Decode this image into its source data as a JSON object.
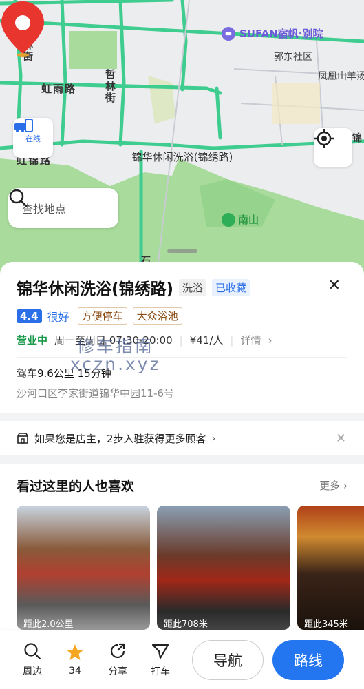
{
  "map": {
    "labels": {
      "sufan": "SUFAN宿帆·别院",
      "guodong": "郭东社区",
      "fenghuang": "凤凰山羊汤",
      "yi_street": "逸林街",
      "hongyu_road": "虹雨路",
      "zhe_street": "哲林街",
      "hong_road": "虹锦路",
      "nanshan": "南山",
      "shi": "石",
      "jin": "锦"
    },
    "pin_label": "锦华休闲洗浴(锦绣路)",
    "online_label": "在线",
    "search_placeholder": "查找地点"
  },
  "place": {
    "name": "锦华休闲洗浴(锦绣路)",
    "category_tag": "洗浴",
    "saved_tag": "已收藏",
    "score": "4.4",
    "score_text": "很好",
    "features": [
      "方便停车",
      "大众浴池"
    ],
    "status": "营业中",
    "hours": "周一至周日 07:30-20:00",
    "price": "¥41/人",
    "detail": "详情",
    "drive": "驾车9.6公里 15分钟",
    "address": "沙河口区李家街道锦华中园11-6号"
  },
  "watermark": {
    "line1": "修车指南",
    "line2": "xczn.xyz"
  },
  "owner_bar": {
    "text": "如果您是店主，2步入驻获得更多顾客"
  },
  "recommend": {
    "title": "看过这里的人也喜欢",
    "more": "更多",
    "cards": [
      {
        "distance": "距此2.0公里",
        "color": "#8a5a3a"
      },
      {
        "distance": "距此708米",
        "color": "#6a3a2a"
      },
      {
        "distance": "距此345米",
        "color": "#3a2418"
      }
    ]
  },
  "bottom_bar": {
    "nearby": "周边",
    "fav_count": "34",
    "share": "分享",
    "taxi": "打车",
    "navigate": "导航",
    "route": "路线"
  },
  "colors": {
    "accent": "#2376f0",
    "open": "#1a9a4a",
    "pin": "#e8362e",
    "road": "#3fcc8f",
    "park": "#a9dc9c"
  }
}
